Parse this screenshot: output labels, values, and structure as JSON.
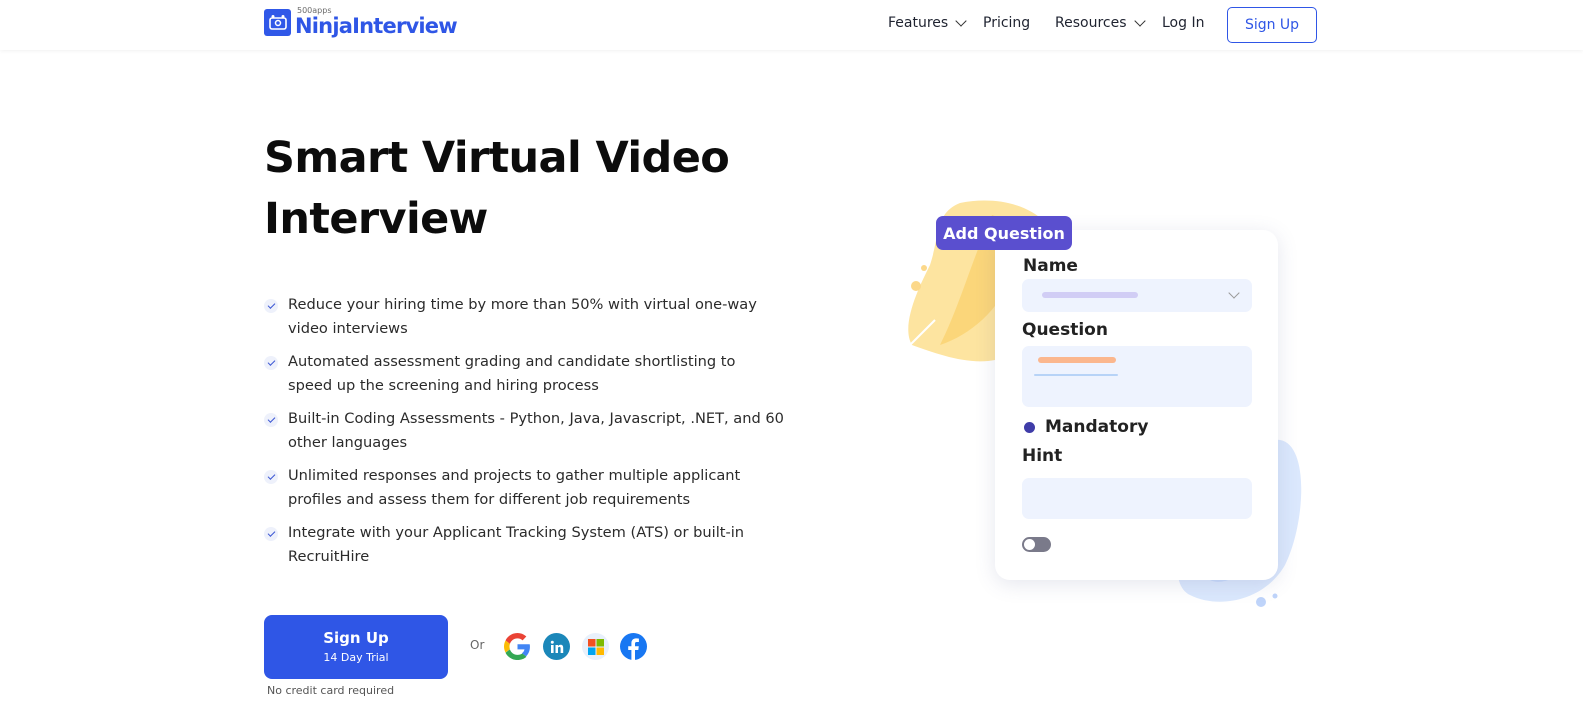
{
  "brand": {
    "sub": "500apps",
    "name": "NinjaInterview",
    "color": "#2f56e6"
  },
  "nav": {
    "features": "Features",
    "pricing": "Pricing",
    "resources": "Resources",
    "login": "Log In",
    "signup": "Sign Up"
  },
  "hero": {
    "title_line1": "Smart Virtual Video",
    "title_line2": "Interview",
    "features": [
      "Reduce your hiring time by more than 50% with virtual one-way video interviews",
      "Automated assessment grading and candidate shortlisting to speed up the screening and hiring process",
      "Built-in Coding Assessments - Python, Java, Javascript, .NET, and 60 other languages",
      "Unlimited responses and projects to gather multiple applicant profiles and assess them for different job requirements",
      "Integrate with your Applicant Tracking System (ATS) or built-in RecruitHire"
    ]
  },
  "cta": {
    "main": "Sign Up",
    "sub": "14 Day Trial",
    "note": "No credit card required",
    "or": "Or",
    "socials": [
      "google-icon",
      "linkedin-icon",
      "microsoft-icon",
      "facebook-icon"
    ]
  },
  "illustration": {
    "button": "Add Question",
    "name_label": "Name",
    "question_label": "Question",
    "mandatory_label": "Mandatory",
    "hint_label": "Hint",
    "accent": "#5a4fcf"
  }
}
